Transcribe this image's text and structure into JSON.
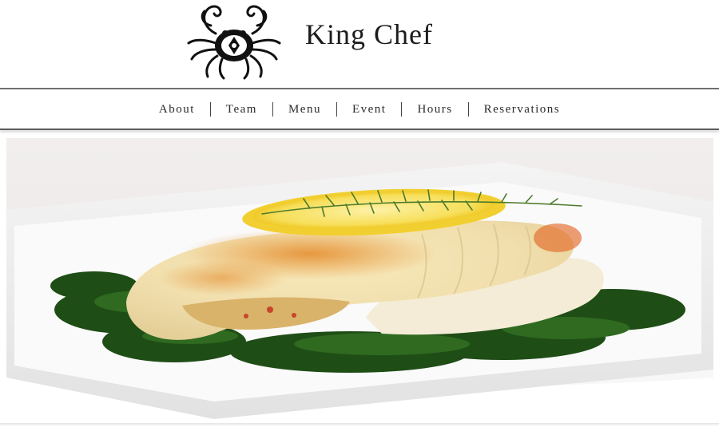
{
  "brand": {
    "name": "King Chef",
    "logo_icon": "crab-logo-icon"
  },
  "nav": {
    "items": [
      {
        "label": "About"
      },
      {
        "label": "Team"
      },
      {
        "label": "Menu"
      },
      {
        "label": "Event"
      },
      {
        "label": "Hours"
      },
      {
        "label": "Reservations"
      }
    ]
  },
  "hero": {
    "image": "fish-fillet-on-spinach-photo"
  },
  "colors": {
    "text": "#2b2b2b",
    "rule": "#6f6f6f",
    "background": "#ffffff"
  }
}
